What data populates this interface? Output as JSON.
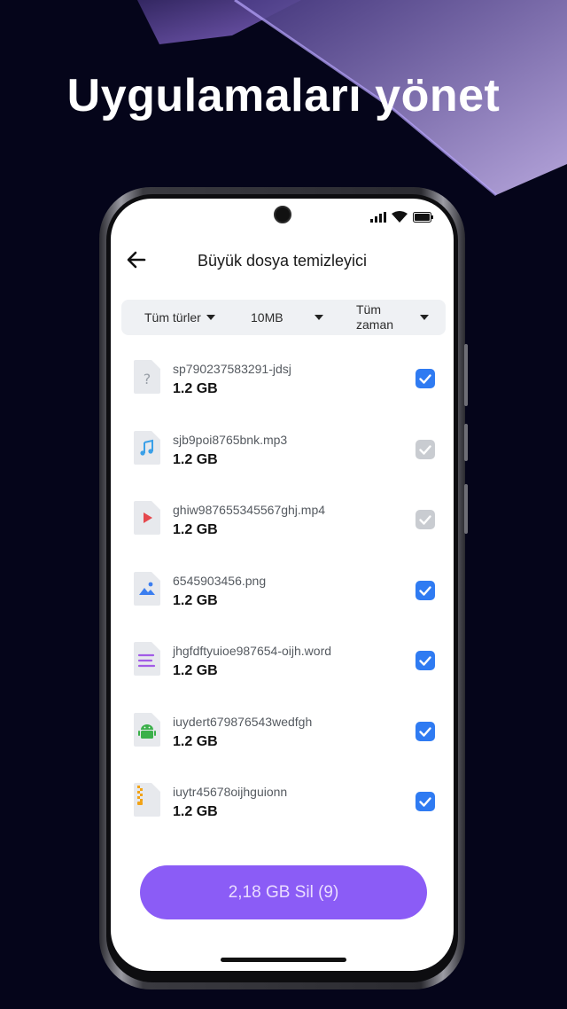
{
  "headline": "Uygulamaları yönet",
  "app_bar": {
    "title": "Büyük dosya temizleyici"
  },
  "filters": {
    "type": "Tüm türler",
    "size": "10MB",
    "time_line1": "Tüm",
    "time_line2": "zaman"
  },
  "files": [
    {
      "name": "sp790237583291-jdsj",
      "size": "1.2 GB",
      "icon": "unknown-file-icon",
      "checked": true
    },
    {
      "name": "sjb9poi8765bnk.mp3",
      "size": "1.2 GB",
      "icon": "audio-file-icon",
      "checked": false
    },
    {
      "name": "ghiw987655345567ghj.mp4",
      "size": "1.2 GB",
      "icon": "video-file-icon",
      "checked": false
    },
    {
      "name": "6545903456.png",
      "size": "1.2 GB",
      "icon": "image-file-icon",
      "checked": true
    },
    {
      "name": "jhgfdftyuioe987654-oijh.word",
      "size": "1.2 GB",
      "icon": "document-file-icon",
      "checked": true
    },
    {
      "name": "iuydert679876543wedfgh",
      "size": "1.2 GB",
      "icon": "android-apk-icon",
      "checked": true
    },
    {
      "name": "iuytr45678oijhguionn",
      "size": "1.2 GB",
      "icon": "zip-archive-icon",
      "checked": true
    }
  ],
  "delete_button": {
    "label": "2,18 GB Sil (9)"
  },
  "colors": {
    "accent": "#8b5cf6",
    "checkbox_checked": "#2f7bf2",
    "checkbox_disabled": "#c9ccd1",
    "background": "#05051a"
  }
}
